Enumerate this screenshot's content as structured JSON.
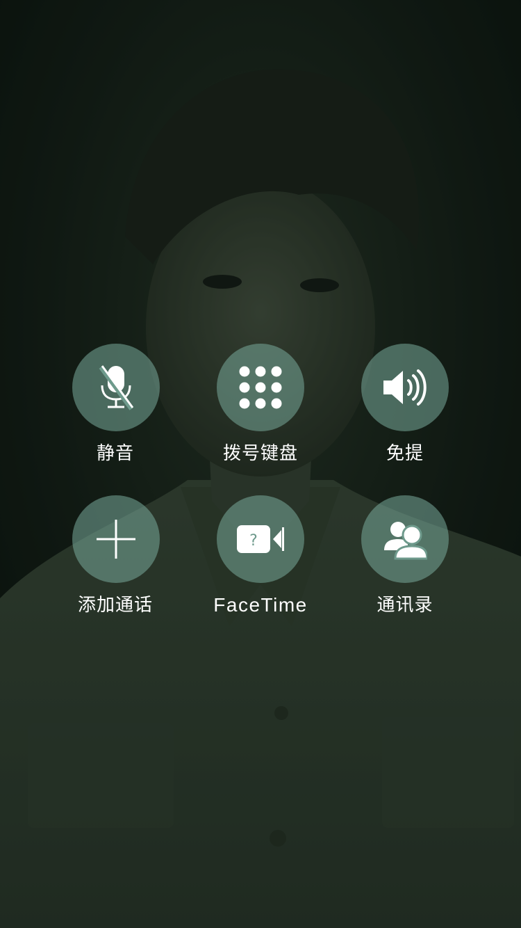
{
  "call_controls": {
    "row1": [
      {
        "label": "静音",
        "icon": "mute-microphone-icon"
      },
      {
        "label": "拨号键盘",
        "icon": "keypad-icon"
      },
      {
        "label": "免提",
        "icon": "speaker-icon"
      }
    ],
    "row2": [
      {
        "label": "添加通话",
        "icon": "plus-icon"
      },
      {
        "label": "FaceTime",
        "icon": "video-camera-question-icon"
      },
      {
        "label": "通讯录",
        "icon": "contacts-icon"
      }
    ]
  },
  "colors": {
    "button_fill": "#78aa9b",
    "text": "#ffffff",
    "background": "#0e1410"
  }
}
